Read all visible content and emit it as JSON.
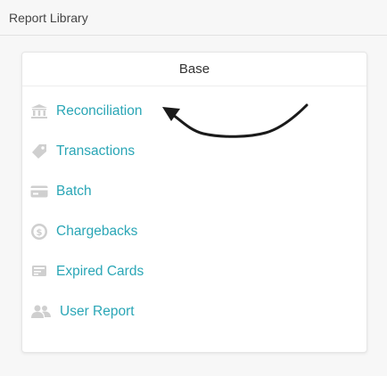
{
  "header": {
    "title": "Report Library"
  },
  "card": {
    "title": "Base",
    "items": [
      {
        "label": "Reconciliation",
        "icon": "bank-icon"
      },
      {
        "label": "Transactions",
        "icon": "tag-icon"
      },
      {
        "label": "Batch",
        "icon": "credit-card-icon"
      },
      {
        "label": "Chargebacks",
        "icon": "dollar-circle-icon"
      },
      {
        "label": "Expired Cards",
        "icon": "expired-card-icon"
      },
      {
        "label": "User Report",
        "icon": "users-icon"
      }
    ]
  },
  "colors": {
    "link": "#2aa6b6",
    "icon": "#cfcfcf",
    "annotation": "#1a1a1a"
  }
}
